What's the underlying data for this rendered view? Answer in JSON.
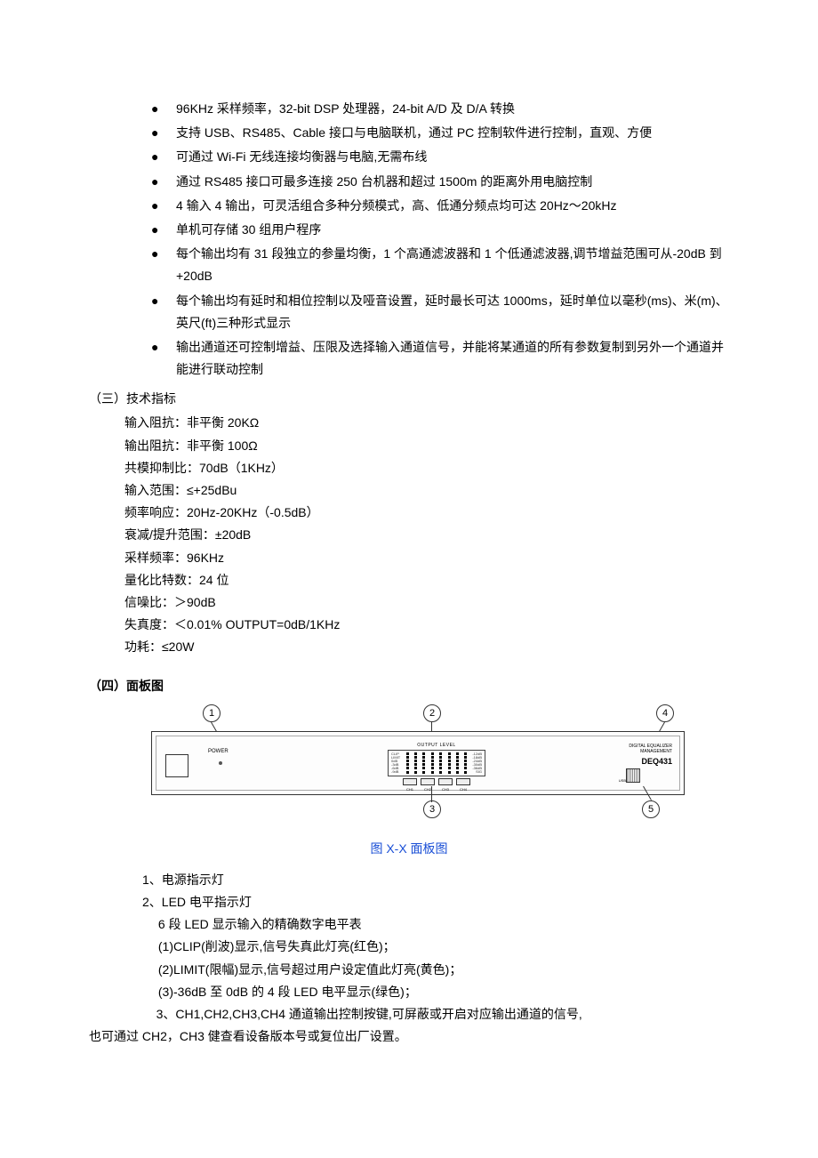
{
  "bullets": [
    "96KHz 采样频率，32-bit DSP 处理器，24-bit A/D 及 D/A 转换",
    "支持 USB、RS485、Cable 接口与电脑联机，通过 PC 控制软件进行控制，直观、方便",
    "可通过 Wi-Fi 无线连接均衡器与电脑,无需布线",
    "通过 RS485 接口可最多连接 250 台机器和超过 1500m 的距离外用电脑控制",
    "4 输入 4 输出，可灵活组合多种分频模式，高、低通分频点均可达 20Hz～20kHz",
    "单机可存储 30 组用户程序",
    "每个输出均有 31 段独立的参量均衡，1 个高通滤波器和 1 个低通滤波器,调节增益范围可从-20dB 到+20dB",
    "每个输出均有延时和相位控制以及哑音设置，延时最长可达 1000ms，延时单位以毫秒(ms)、米(m)、英尺(ft)三种形式显示",
    "输出通道还可控制增益、压限及选择输入通道信号，并能将某通道的所有参数复制到另外一个通道并能进行联动控制"
  ],
  "section3": {
    "title": "（三）技术指标",
    "specs": [
      "输入阻抗：非平衡 20KΩ",
      "输出阻抗：非平衡 100Ω",
      "共模抑制比：70dB（1KHz）",
      "输入范围：≤+25dBu",
      "频率响应：20Hz-20KHz（-0.5dB）",
      "衰减/提升范围：±20dB",
      "采样频率：96KHz",
      "量化比特数：24 位",
      "信噪比：＞90dB",
      "失真度：＜0.01% OUTPUT=0dB/1KHz",
      "功耗：≤20W"
    ]
  },
  "section4": {
    "title": "（四）面板图",
    "callouts": {
      "c1": "1",
      "c2": "2",
      "c3": "3",
      "c4": "4",
      "c5": "5"
    },
    "panel": {
      "power": "POWER",
      "output_level": "OUTPUT LEVEL",
      "led_left": [
        "CLIP",
        "LIMIT",
        "0dB",
        "-3dB",
        "-6dB",
        "-9dB"
      ],
      "led_right": [
        "-12dB",
        "-18dB",
        "-24dB",
        "-30dB",
        "-36dB",
        "SIG"
      ],
      "channels": [
        "CH1",
        "CH2",
        "CH3",
        "CH4"
      ],
      "brand_line1": "DIGITAL EQUALIZER",
      "brand_line2": "MANAGEMENT",
      "product": "DEQ431",
      "usb_label": "USB"
    },
    "caption": "图 X-X 面板图",
    "desc": [
      "1、电源指示灯",
      "2、LED 电平指示灯",
      " 6 段 LED 显示输入的精确数字电平表",
      " (1)CLIP(削波)显示,信号失真此灯亮(红色)；",
      " (2)LIMIT(限幅)显示,信号超过用户设定值此灯亮(黄色)；",
      " (3)-36dB 至 0dB 的 4 段 LED 电平显示(绿色)；",
      "    3、CH1,CH2,CH3,CH4 通道输出控制按键,可屏蔽或开启对应输出通道的信号,",
      "也可通过 CH2，CH3 健查看设备版本号或复位出厂设置。"
    ]
  }
}
